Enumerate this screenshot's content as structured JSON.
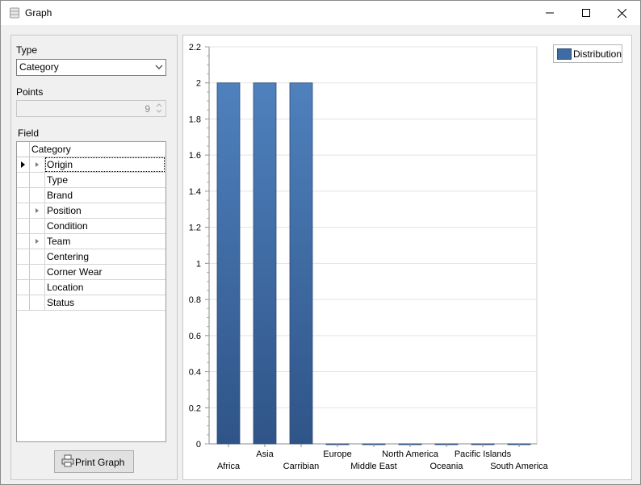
{
  "window": {
    "title": "Graph",
    "icon": "database-icon",
    "controls": [
      "minimize-icon",
      "maximize-icon",
      "close-icon"
    ]
  },
  "left": {
    "type_label": "Type",
    "type_value": "Category",
    "points_label": "Points",
    "points_value": "9",
    "field_label": "Field",
    "grid_header": "Category",
    "fields": [
      {
        "label": "Origin",
        "expandable": true,
        "current": true
      },
      {
        "label": "Type",
        "expandable": false
      },
      {
        "label": "Brand",
        "expandable": false
      },
      {
        "label": "Position",
        "expandable": true
      },
      {
        "label": "Condition",
        "expandable": false
      },
      {
        "label": "Team",
        "expandable": true
      },
      {
        "label": "Centering",
        "expandable": false
      },
      {
        "label": "Corner Wear",
        "expandable": false
      },
      {
        "label": "Location",
        "expandable": false
      },
      {
        "label": "Status",
        "expandable": false
      }
    ],
    "print_label": "Print Graph"
  },
  "colors": {
    "bar_top": "#4f81bd",
    "bar_bottom": "#2f5488",
    "grid": "#e3e3e3"
  },
  "chart_data": {
    "type": "bar",
    "categories": [
      "Africa",
      "Asia",
      "Carribian",
      "Europe",
      "Middle East",
      "North America",
      "Oceania",
      "Pacific Islands",
      "South America"
    ],
    "series": [
      {
        "name": "Distribution",
        "values": [
          2,
          2,
          2,
          0,
          0,
          0,
          0,
          0,
          0
        ]
      }
    ],
    "ylim": [
      0,
      2.2
    ],
    "yticks": [
      "0",
      "0.2",
      "0.4",
      "0.6",
      "0.8",
      "1",
      "1.2",
      "1.4",
      "1.6",
      "1.8",
      "2",
      "2.2"
    ],
    "grid": true,
    "legend_position": "top-right"
  }
}
